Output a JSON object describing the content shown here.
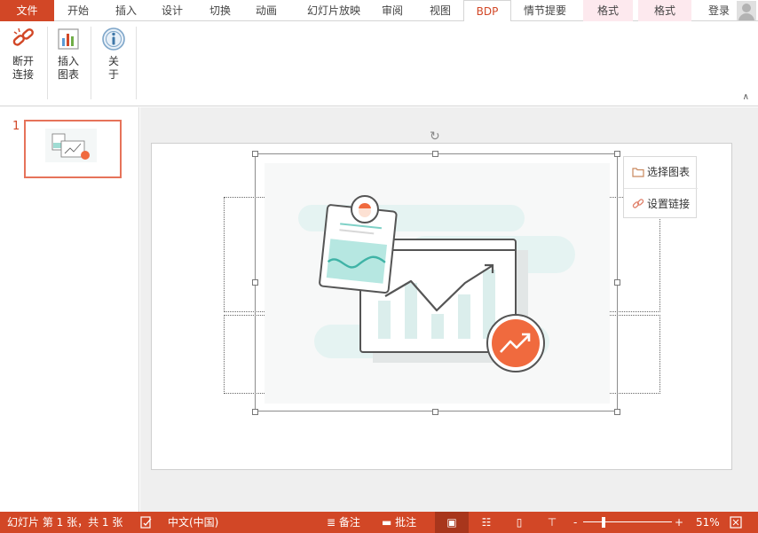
{
  "tabs": [
    {
      "label": "文件"
    },
    {
      "label": "开始"
    },
    {
      "label": "插入"
    },
    {
      "label": "设计"
    },
    {
      "label": "切换"
    },
    {
      "label": "动画"
    },
    {
      "label": "幻灯片放映"
    },
    {
      "label": "审阅"
    },
    {
      "label": "视图"
    },
    {
      "label": "BDP"
    },
    {
      "label": "情节提要"
    },
    {
      "label": "格式"
    },
    {
      "label": "格式"
    },
    {
      "label": "登录"
    }
  ],
  "ribbon": {
    "disconnect": {
      "line1": "断开",
      "line2": "连接"
    },
    "insert_chart": {
      "line1": "插入",
      "line2": "图表"
    },
    "about": {
      "line1": "关",
      "line2": "于"
    }
  },
  "thumbnails": {
    "slide_number": "1"
  },
  "side_menu": {
    "select_chart": "选择图表",
    "set_link": "设置链接"
  },
  "status": {
    "slide_info": "幻灯片 第 1 张，共 1 张",
    "language": "中文(中国)",
    "notes": "备注",
    "comments": "批注",
    "zoom_minus": "-",
    "zoom_plus": "+",
    "zoom": "51%"
  },
  "colors": {
    "accent": "#d24726",
    "teal": "#7fd1c7",
    "orange": "#f06a3e"
  }
}
